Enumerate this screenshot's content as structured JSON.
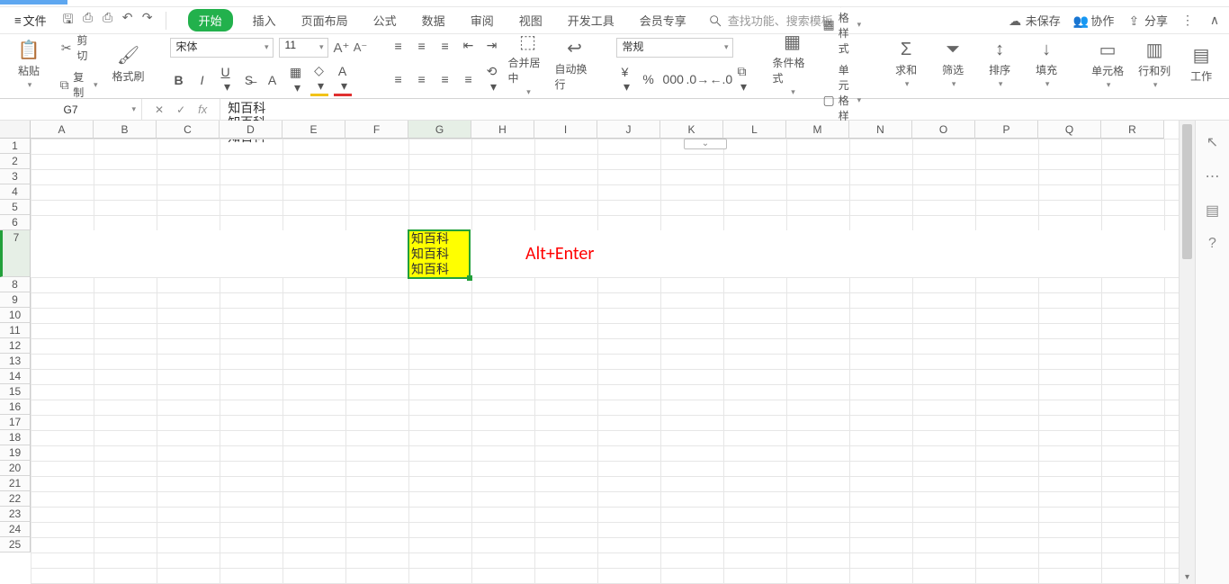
{
  "menu": {
    "file": "文件",
    "tabs": [
      "开始",
      "插入",
      "页面布局",
      "公式",
      "数据",
      "审阅",
      "视图",
      "开发工具",
      "会员专享"
    ],
    "active_tab": 0,
    "search_placeholder": "查找功能、搜索模板"
  },
  "right": {
    "unsaved": "未保存",
    "collab": "协作",
    "share": "分享"
  },
  "ribbon": {
    "paste": "粘贴",
    "cut": "剪切",
    "copy": "复制",
    "format_painter": "格式刷",
    "font_name": "宋体",
    "font_size": "11",
    "merge_center": "合并居中",
    "auto_wrap": "自动换行",
    "number_format": "常规",
    "cond_fmt": "条件格式",
    "table_style": "表格样式",
    "cell_style": "单元格样式",
    "sum": "求和",
    "filter": "筛选",
    "sort": "排序",
    "fill": "填充",
    "cell": "单元格",
    "rowcol": "行和列",
    "worksheet": "工作"
  },
  "namebox": "G7",
  "formula_lines": [
    "知百科",
    "知百科",
    "知百科"
  ],
  "columns": [
    "A",
    "B",
    "C",
    "D",
    "E",
    "F",
    "G",
    "H",
    "I",
    "J",
    "K",
    "L",
    "M",
    "N",
    "O",
    "P",
    "Q",
    "R"
  ],
  "selected_col_label": "G",
  "row_start": 1,
  "row_end": 25,
  "selected_row": 7,
  "active_cell": {
    "col_idx": 6,
    "row_idx": 6,
    "lines": [
      "知百科",
      "知百科",
      "知百科"
    ]
  },
  "annotation": "Alt+Enter"
}
